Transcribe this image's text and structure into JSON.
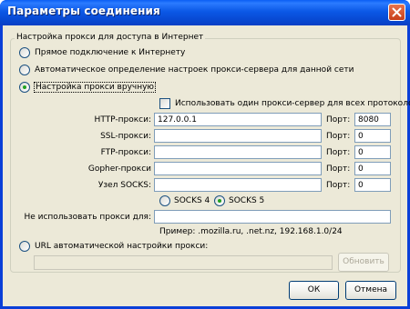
{
  "window": {
    "title": "Параметры соединения"
  },
  "group": {
    "title": "Настройка прокси для доступа в Интернет",
    "options": [
      {
        "label": "Прямое подключение к Интернету",
        "checked": false
      },
      {
        "label": "Автоматическое определение настроек прокси-сервера для данной сети",
        "checked": false
      },
      {
        "label": "Настройка прокси вручную",
        "checked": true
      }
    ],
    "same_proxy_label": "Использовать один прокси-сервер для всех протоколов",
    "proxies": [
      {
        "label": "HTTP-прокси:",
        "host": "127.0.0.1",
        "port_label": "Порт:",
        "port": "8080"
      },
      {
        "label": "SSL-прокси:",
        "host": "",
        "port_label": "Порт:",
        "port": "0"
      },
      {
        "label": "FTP-прокси:",
        "host": "",
        "port_label": "Порт:",
        "port": "0"
      },
      {
        "label": "Gopher-прокси",
        "host": "",
        "port_label": "Порт:",
        "port": "0"
      },
      {
        "label": "Узел SOCKS:",
        "host": "",
        "port_label": "Порт:",
        "port": "0"
      }
    ],
    "socks": [
      {
        "label": "SOCKS 4",
        "checked": false
      },
      {
        "label": "SOCKS 5",
        "checked": true
      }
    ],
    "no_proxy_label": "Не использовать прокси для:",
    "no_proxy_value": "",
    "example": "Пример: .mozilla.ru, .net.nz, 192.168.1.0/24",
    "auto_url_label": "URL автоматической настройки прокси:",
    "auto_url_value": "",
    "reload_label": "Обновить"
  },
  "buttons": {
    "ok": "ОК",
    "cancel": "Отмена"
  }
}
